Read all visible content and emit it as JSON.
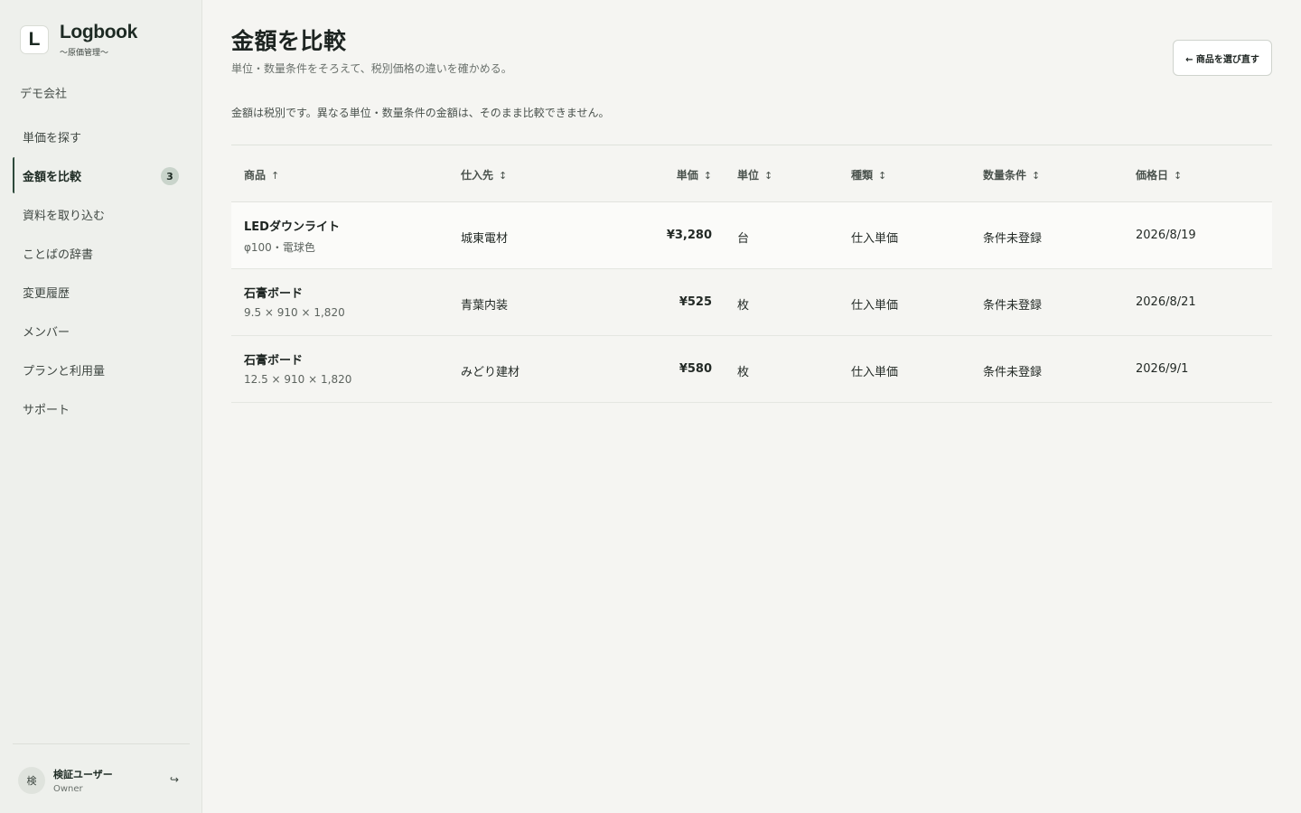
{
  "sidebar": {
    "logo_letter": "L",
    "brand_name": "Logbook",
    "brand_sub": "〜原価管理〜",
    "org_name": "デモ会社",
    "items": [
      {
        "label": "単価を探す"
      },
      {
        "label": "金額を比較",
        "badge": "3"
      },
      {
        "label": "資料を取り込む"
      },
      {
        "label": "ことばの辞書"
      },
      {
        "label": "変更履歴"
      },
      {
        "label": "メンバー"
      },
      {
        "label": "プランと利用量"
      },
      {
        "label": "サポート"
      }
    ],
    "user": {
      "avatar": "検",
      "name": "検証ユーザー",
      "role": "Owner",
      "logout_icon": "↪"
    }
  },
  "main": {
    "title": "金額を比較",
    "subtitle": "単位・数量条件をそろえて、税別価格の違いを確かめる。",
    "back_label": "← 商品を選び直す",
    "note": "金額は税別です。異なる単位・数量条件の金額は、そのまま比較できません。"
  },
  "table": {
    "headers": {
      "product": "商品",
      "product_sort": "↑",
      "supplier": "仕入先",
      "supplier_sort": "↕",
      "price": "単価",
      "price_sort": "↕",
      "unit": "単位",
      "unit_sort": "↕",
      "kind": "種類",
      "kind_sort": "↕",
      "qty": "数量条件",
      "qty_sort": "↕",
      "date": "価格日",
      "date_sort": "↕"
    },
    "rows": [
      {
        "name": "LEDダウンライト",
        "spec": "φ100・電球色",
        "supplier": "城東電材",
        "price": "¥3,280",
        "unit": "台",
        "kind": "仕入単価",
        "qty": "条件未登録",
        "date": "2026/8/19"
      },
      {
        "name": "石膏ボード",
        "spec": "9.5 × 910 × 1,820",
        "supplier": "青葉内装",
        "price": "¥525",
        "unit": "枚",
        "kind": "仕入単価",
        "qty": "条件未登録",
        "date": "2026/8/21"
      },
      {
        "name": "石膏ボード",
        "spec": "12.5 × 910 × 1,820",
        "supplier": "みどり建材",
        "price": "¥580",
        "unit": "枚",
        "kind": "仕入単価",
        "qty": "条件未登録",
        "date": "2026/9/1"
      }
    ]
  }
}
